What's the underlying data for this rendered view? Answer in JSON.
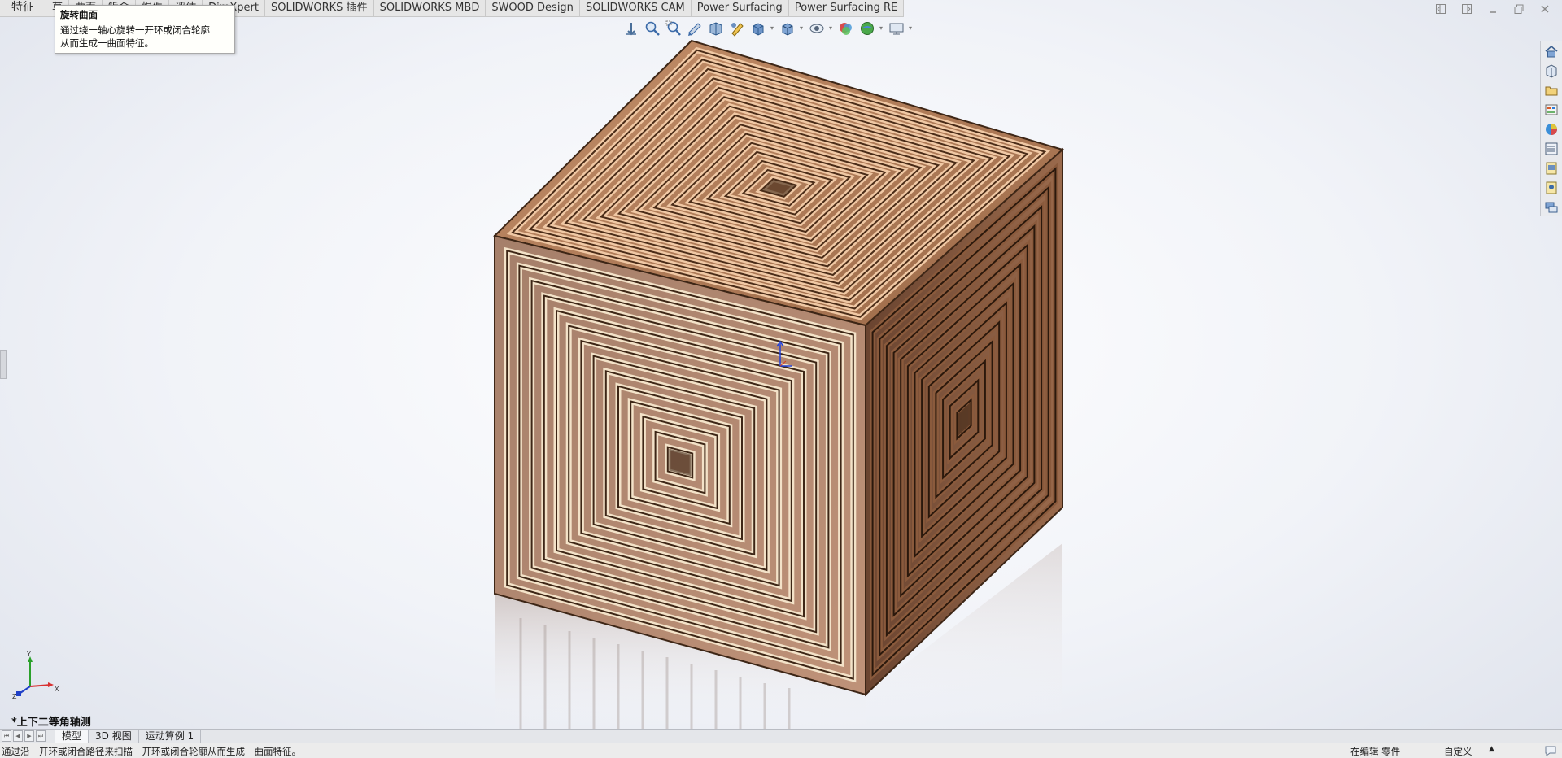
{
  "command_tabs": [
    "特征",
    "草",
    "曲面",
    "钣金",
    "焊件",
    "评估",
    "DimXpert",
    "SOLIDWORKS 插件",
    "SOLIDWORKS MBD",
    "SWOOD Design",
    "SOLIDWORKS CAM",
    "Power Surfacing",
    "Power Surfacing RE"
  ],
  "tooltip": {
    "title": "旋转曲面",
    "line1": "通过绕一轴心旋转一开环或闭合轮廓",
    "line2": "从而生成一曲面特征。"
  },
  "hud_icons": [
    "view-orientation-icon",
    "zoom-to-fit-icon",
    "zoom-to-area-icon",
    "previous-view-icon",
    "section-view-icon",
    "dynamic-annotation-icon",
    "view-orientation-menu-icon",
    "display-style-icon",
    "hide-show-items-icon",
    "edit-appearance-icon",
    "apply-scene-icon",
    "view-settings-icon"
  ],
  "taskpane_icons": [
    "home-icon",
    "design-library-icon",
    "file-explorer-icon",
    "view-palette-icon",
    "appearances-icon",
    "custom-properties-icon",
    "solidworks-resources-icon",
    "help-icon",
    "forum-icon"
  ],
  "triad": {
    "x": "X",
    "y": "Y",
    "z": "Z"
  },
  "view_name": "*上下二等角轴测",
  "bottom_tabs": [
    "模型",
    "3D 视图",
    "运动算例 1"
  ],
  "status": {
    "message": "通过沿一开环或闭合路径来扫描一开环或闭合轮廓从而生成一曲面特征。",
    "mode": "在编辑 零件",
    "units": "自定义"
  },
  "colors": {
    "wood_light": "#e8b894",
    "wood_mid": "#b07a55",
    "wood_dark": "#5e3a22",
    "background": "#f1f3f8"
  }
}
